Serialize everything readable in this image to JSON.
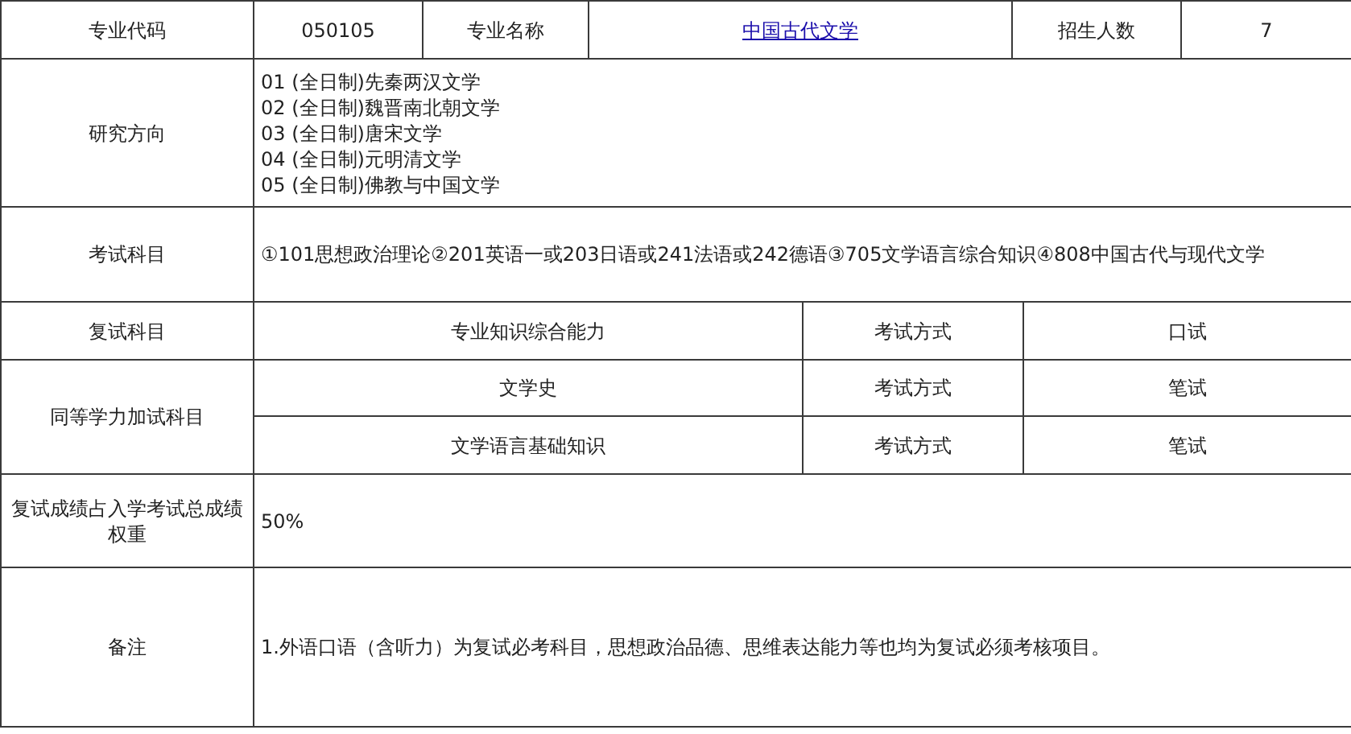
{
  "header": {
    "code_label": "专业代码",
    "code": "050105",
    "name_label": "专业名称",
    "name": "中国古代文学",
    "quota_label": "招生人数",
    "quota": "7"
  },
  "research": {
    "label": "研究方向",
    "items": [
      "01 (全日制)先秦两汉文学",
      "02 (全日制)魏晋南北朝文学",
      "03 (全日制)唐宋文学",
      "04 (全日制)元明清文学",
      "05 (全日制)佛教与中国文学"
    ]
  },
  "exam": {
    "label": "考试科目",
    "value": "①101思想政治理论②201英语一或203日语或241法语或242德语③705文学语言综合知识④808中国古代与现代文学"
  },
  "retest": {
    "label": "复试科目",
    "rows": [
      {
        "subject": "专业知识综合能力",
        "method_label": "考试方式",
        "method": "口试"
      }
    ]
  },
  "extra": {
    "label": "同等学力加试科目",
    "rows": [
      {
        "subject": "文学史",
        "method_label": "考试方式",
        "method": "笔试"
      },
      {
        "subject": "文学语言基础知识",
        "method_label": "考试方式",
        "method": "笔试"
      }
    ]
  },
  "weight": {
    "label": "复试成绩占入学考试总成绩权重",
    "value": "50%"
  },
  "notes": {
    "label": "备注",
    "value": "1.外语口语（含听力）为复试必考科目，思想政治品德、思维表达能力等也均为复试必须考核项目。"
  }
}
